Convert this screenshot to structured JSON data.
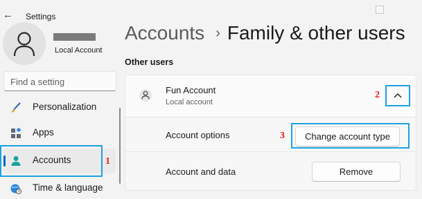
{
  "window": {
    "title": "Settings"
  },
  "profile": {
    "account_type": "Local Account"
  },
  "search": {
    "placeholder": "Find a setting"
  },
  "nav": {
    "items": [
      {
        "label": "Personalization",
        "icon": "brush-icon"
      },
      {
        "label": "Apps",
        "icon": "apps-icon"
      },
      {
        "label": "Accounts",
        "icon": "person-icon"
      },
      {
        "label": "Time & language",
        "icon": "globe-clock-icon"
      }
    ],
    "active": "Accounts"
  },
  "breadcrumb": {
    "parent": "Accounts",
    "separator": "›",
    "current": "Family & other users"
  },
  "section": {
    "title": "Other users"
  },
  "user": {
    "name": "Fun Account",
    "type": "Local account"
  },
  "rows": {
    "account_options": {
      "label": "Account options",
      "button": "Change account type"
    },
    "account_data": {
      "label": "Account and data",
      "button": "Remove"
    }
  },
  "steps": {
    "one": "1",
    "two": "2",
    "three": "3"
  },
  "colors": {
    "accent": "#0067c0",
    "highlight": "#1ba1e2",
    "step_number": "#e21b1b"
  }
}
